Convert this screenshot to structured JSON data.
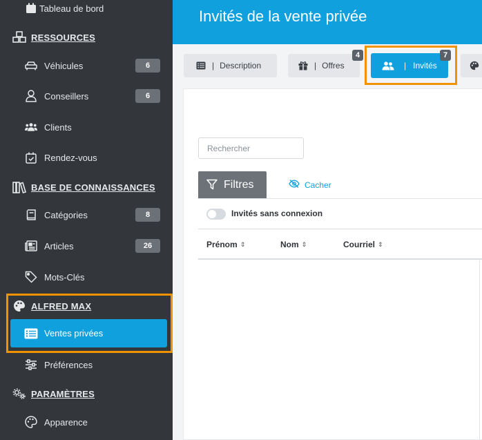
{
  "sidebar": {
    "top_item": {
      "label": "Tableau de bord",
      "icon": "calendar-icon"
    },
    "sections": [
      {
        "label": "RESSOURCES",
        "icon": "cubes-icon",
        "items": [
          {
            "label": "Véhicules",
            "icon": "car-icon",
            "badge": "6"
          },
          {
            "label": "Conseillers",
            "icon": "user-tie-icon",
            "badge": "6"
          },
          {
            "label": "Clients",
            "icon": "users-icon",
            "badge": ""
          },
          {
            "label": "Rendez-vous",
            "icon": "calendar-check-icon",
            "badge": ""
          }
        ]
      },
      {
        "label": "BASE DE CONNAISSANCES",
        "icon": "books-icon",
        "items": [
          {
            "label": "Catégories",
            "icon": "book-icon",
            "badge": "8"
          },
          {
            "label": "Articles",
            "icon": "newspaper-icon",
            "badge": "26"
          },
          {
            "label": "Mots-Clés",
            "icon": "tag-icon",
            "badge": ""
          }
        ]
      },
      {
        "label": "ALFRED MAX",
        "icon": "palette-icon",
        "items": [
          {
            "label": "Ventes privées",
            "icon": "list-icon",
            "badge": "",
            "active": true
          },
          {
            "label": "Préférences",
            "icon": "sliders-icon",
            "badge": ""
          }
        ]
      },
      {
        "label": "PARAMÈTRES",
        "icon": "cogs-icon",
        "items": [
          {
            "label": "Apparence",
            "icon": "palette-icon",
            "badge": ""
          }
        ]
      }
    ]
  },
  "header": {
    "title": "Invités de la vente privée"
  },
  "tabs": [
    {
      "label": "Description",
      "icon": "list-icon",
      "count": ""
    },
    {
      "label": "Offres",
      "icon": "gift-icon",
      "count": "4"
    },
    {
      "label": "Invités",
      "icon": "users-icon",
      "count": "7",
      "active": true
    }
  ],
  "content": {
    "search_placeholder": "Rechercher",
    "filters_label": "Filtres",
    "hide_label": "Cacher",
    "toggle_label": "Invités sans connexion",
    "columns": [
      "Prénom",
      "Nom",
      "Courriel"
    ],
    "sort_glyph": "⇕"
  },
  "colors": {
    "accent": "#0fa0dd",
    "sidebar_bg": "#33363b",
    "highlight": "#f39200",
    "badge_bg": "#6b7177"
  }
}
